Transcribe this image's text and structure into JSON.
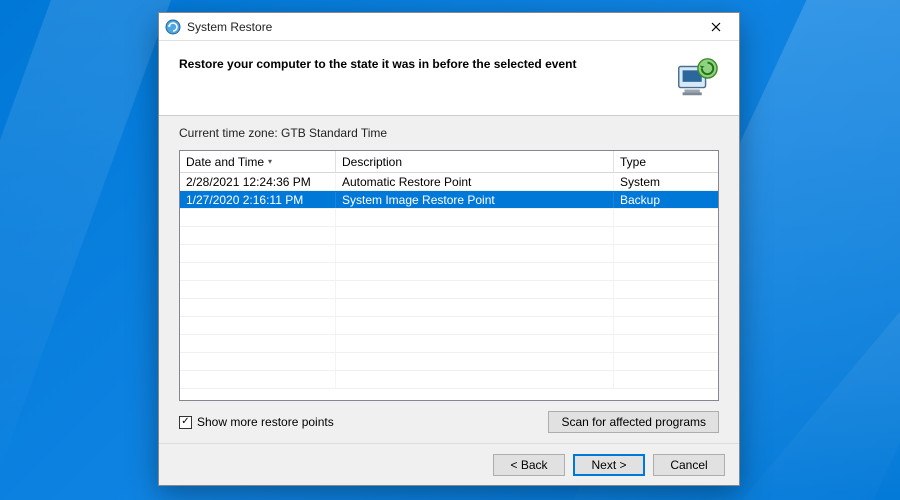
{
  "titlebar": {
    "title": "System Restore"
  },
  "header": {
    "heading": "Restore your computer to the state it was in before the selected event"
  },
  "content": {
    "timezone_label_prefix": "Current time zone: ",
    "timezone_value": "GTB Standard Time"
  },
  "table": {
    "columns": {
      "date": "Date and Time",
      "desc": "Description",
      "type": "Type"
    },
    "rows": [
      {
        "date": "2/28/2021 12:24:36 PM",
        "desc": "Automatic Restore Point",
        "type": "System",
        "selected": false
      },
      {
        "date": "1/27/2020 2:16:11 PM",
        "desc": "System Image Restore Point",
        "type": "Backup",
        "selected": true
      }
    ]
  },
  "checkbox": {
    "label": "Show more restore points",
    "checked": true
  },
  "buttons": {
    "scan": "Scan for affected programs",
    "back": "< Back",
    "next": "Next >",
    "cancel": "Cancel"
  }
}
